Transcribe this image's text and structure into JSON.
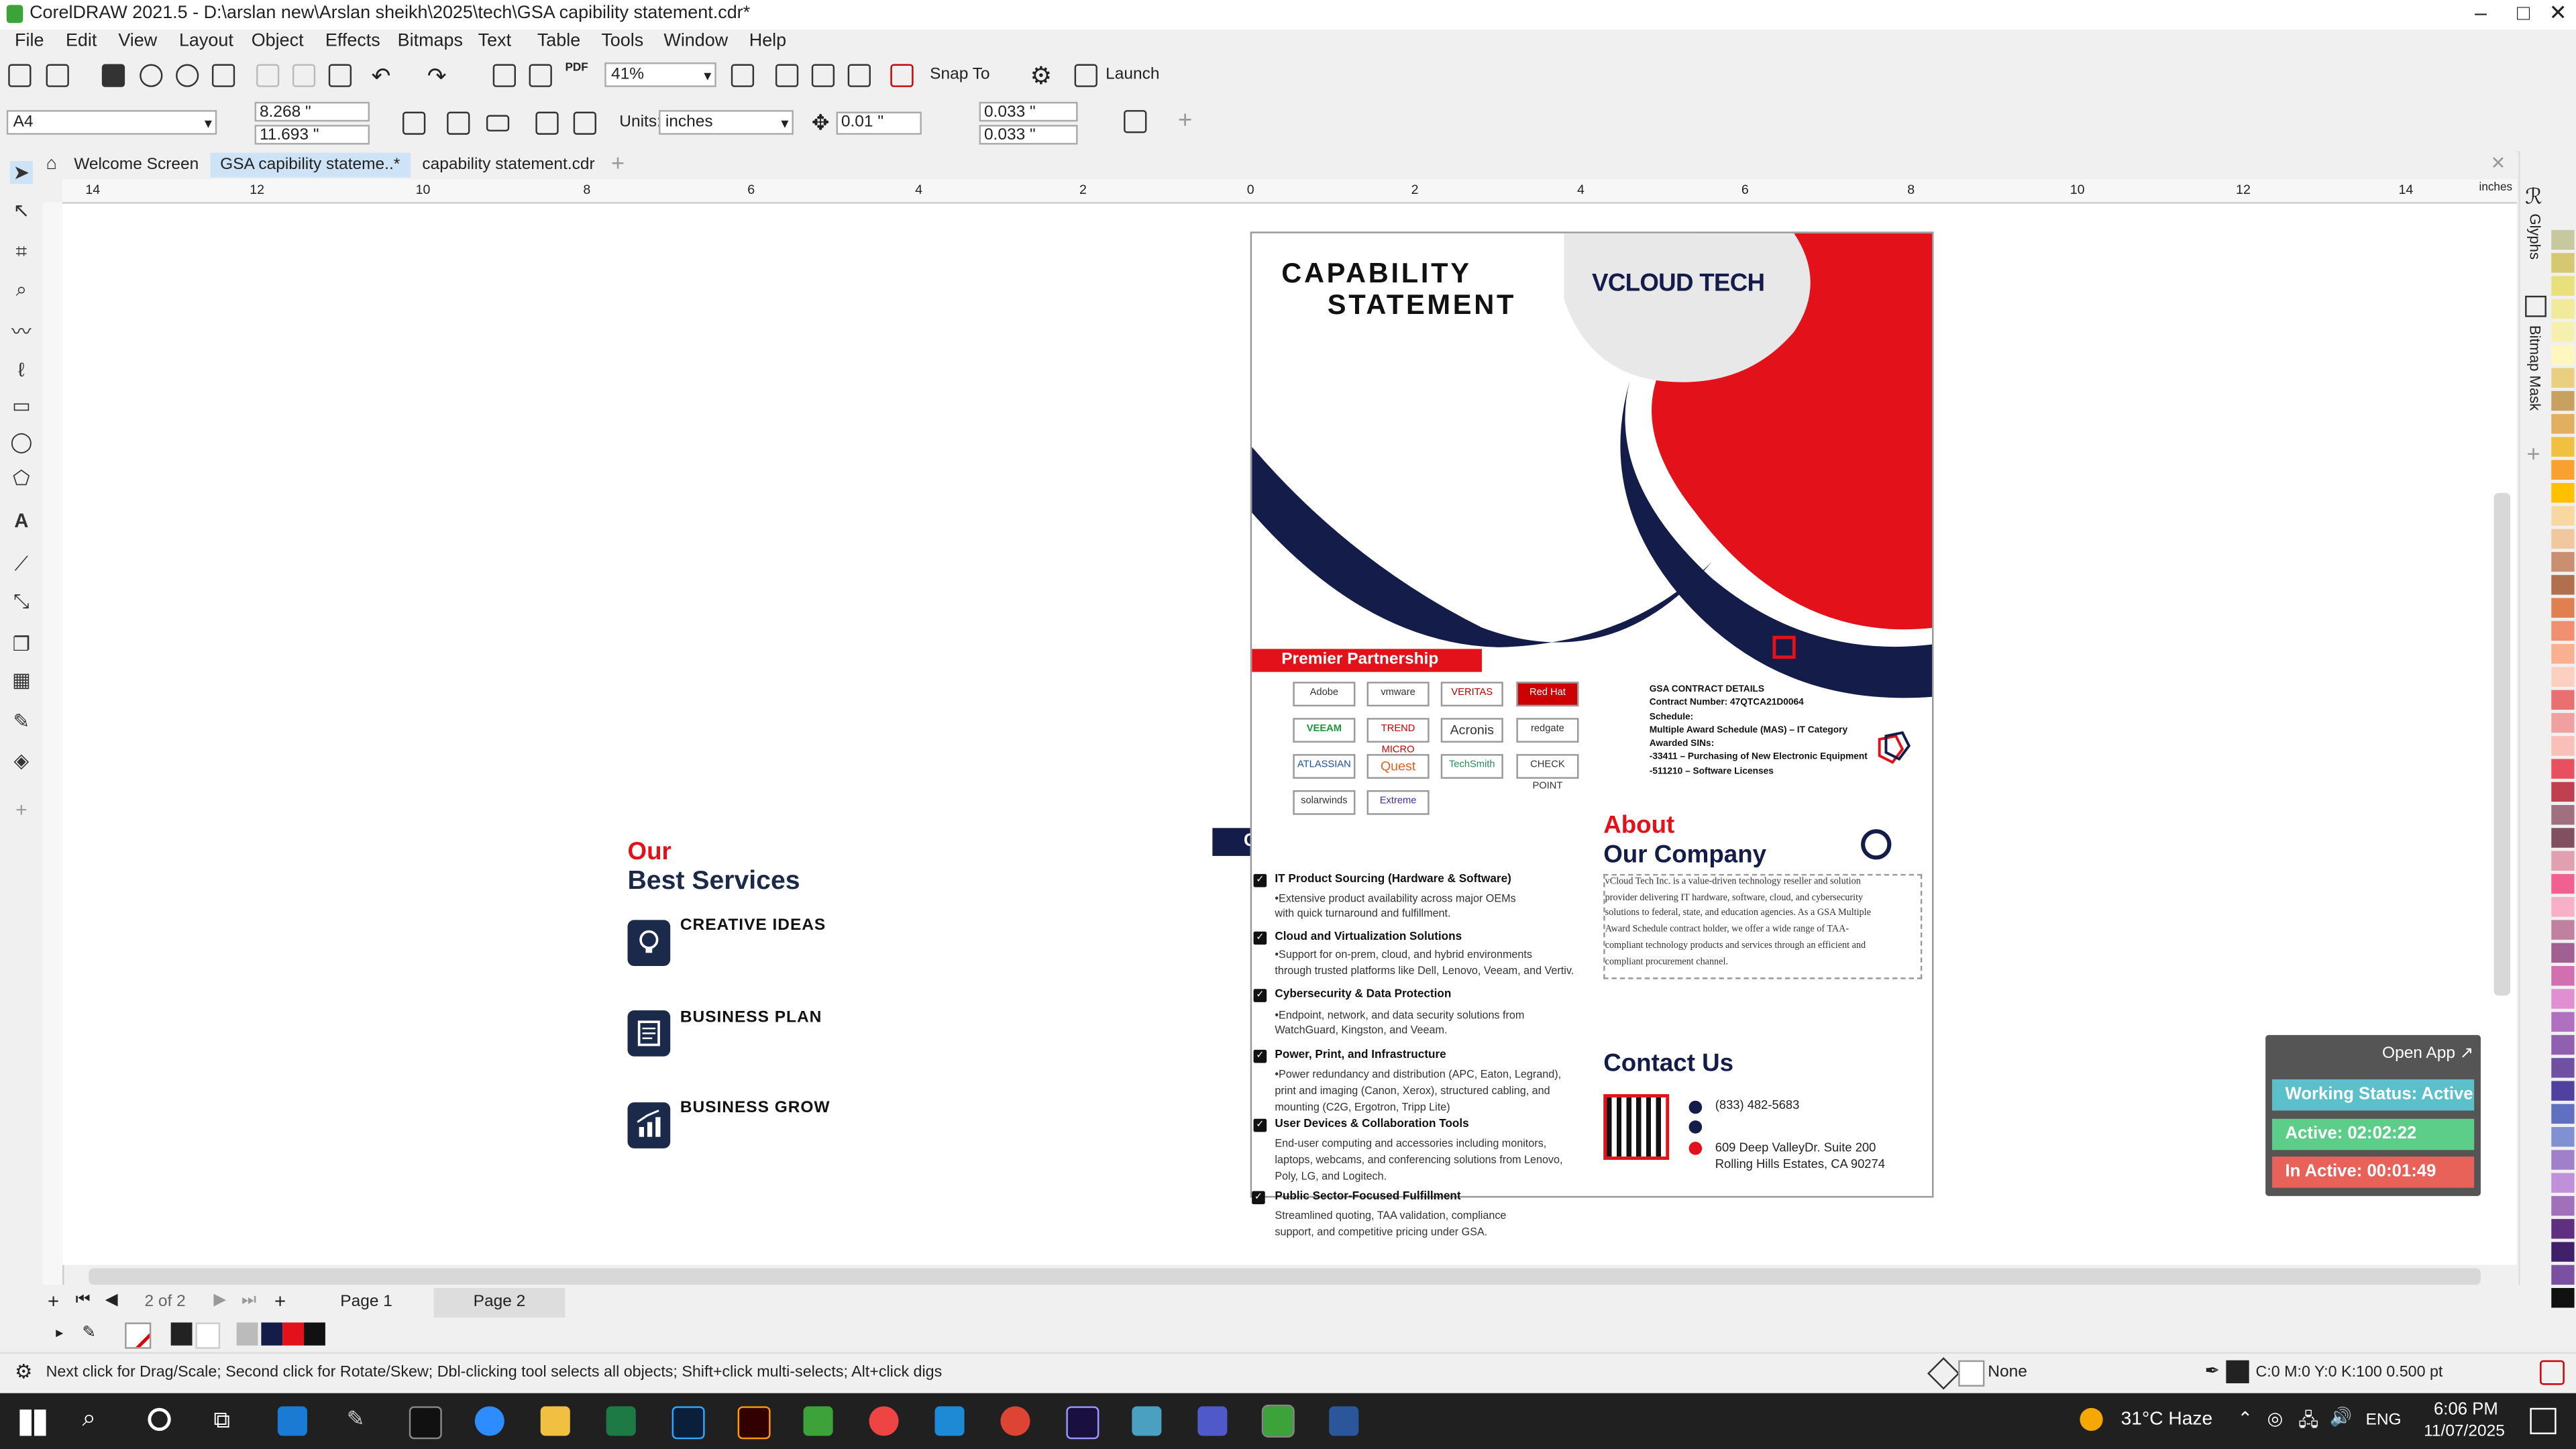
{
  "window": {
    "title": "CorelDRAW 2021.5 - D:\\arslan new\\Arslan sheikh\\2025\\tech\\GSA   capibility statement.cdr*"
  },
  "menu": [
    "File",
    "Edit",
    "View",
    "Layout",
    "Object",
    "Effects",
    "Bitmaps",
    "Text",
    "Table",
    "Tools",
    "Window",
    "Help"
  ],
  "toolbar": {
    "zoom": "41%",
    "snap_to": "Snap To",
    "launch": "Launch"
  },
  "propbar": {
    "page_size": "A4",
    "width": "8.268 \"",
    "height": "11.693 \"",
    "units_label": "Units:",
    "units": "inches",
    "nudge": "0.01 \"",
    "dup_x": "0.033 \"",
    "dup_y": "0.033 \""
  },
  "tabs": [
    "Welcome Screen",
    "GSA   capibility stateme..*",
    "capability statement.cdr"
  ],
  "ruler": {
    "labels": [
      "14",
      "12",
      "10",
      "8",
      "6",
      "4",
      "2",
      "0",
      "2",
      "4",
      "6",
      "8",
      "10",
      "12",
      "14"
    ],
    "unit": "inches"
  },
  "right_dockers": [
    "Glyphs",
    "Bitmap Mask"
  ],
  "document": {
    "header": {
      "line1": "CAPABILITY",
      "line2": "STATEMENT",
      "logo": "VCLOUD TECH"
    },
    "premier": {
      "title": "Premier Partnership",
      "logos": [
        "Adobe",
        "vmware",
        "VERITAS",
        "Red Hat",
        "VEEAM",
        "TREND MICRO",
        "Acronis",
        "redgate",
        "ATLASSIAN",
        "Quest",
        "TechSmith",
        "CHECK POINT",
        "solarwinds",
        "Extreme"
      ]
    },
    "gsa": {
      "lines": [
        "GSA CONTRACT DETAILS",
        "Contract Number: 47QTCA21D0064",
        "Schedule:",
        "Multiple Award Schedule (MAS) – IT Category",
        "Awarded SINs:",
        "-33411 – Purchasing of New Electronic Equipment",
        "-511210 – Software Licenses"
      ]
    },
    "core": {
      "title": "Core Competencies",
      "items": [
        {
          "title": "IT Product Sourcing (Hardware & Software)",
          "desc1": "•Extensive product availability across major OEMs",
          "desc2": "with quick turnaround and fulfillment."
        },
        {
          "title": "Cloud and Virtualization Solutions",
          "desc1": "•Support for on-prem, cloud, and hybrid environments",
          "desc2": "through trusted platforms like Dell, Lenovo, Veeam, and Vertiv."
        },
        {
          "title": "Cybersecurity & Data Protection",
          "desc1": "•Endpoint, network, and data security solutions from",
          "desc2": "WatchGuard, Kingston, and Veeam."
        },
        {
          "title": "Power, Print, and Infrastructure",
          "desc1": "•Power redundancy and distribution (APC, Eaton, Legrand),",
          "desc2": "print and imaging (Canon, Xerox), structured cabling, and",
          "desc3": "mounting (C2G, Ergotron, Tripp Lite)"
        },
        {
          "title": "User Devices & Collaboration Tools",
          "desc1": "End-user computing and accessories including monitors,",
          "desc2": "laptops, webcams, and conferencing solutions from Lenovo,",
          "desc3": "Poly, LG, and Logitech."
        },
        {
          "title": "Public Sector-Focused Fulfillment",
          "desc1": "Streamlined quoting, TAA validation, compliance",
          "desc2": "support, and competitive pricing under GSA."
        }
      ]
    },
    "about": {
      "title1": "About",
      "title2": "Our Company",
      "text": [
        "vCloud Tech Inc. is a value-driven technology reseller and solution",
        "provider delivering IT hardware, software, cloud, and cybersecurity",
        "solutions to federal, state, and education agencies. As a GSA Multiple",
        "Award Schedule contract holder, we offer a wide range of TAA-",
        "compliant technology products and services through an efficient and",
        "compliant procurement channel."
      ]
    },
    "contact": {
      "title": "Contact Us",
      "phone": "(833) 482-5683",
      "address1": "609 Deep ValleyDr. Suite 200",
      "address2": "Rolling Hills Estates, CA 90274"
    }
  },
  "services": {
    "title1": "Our",
    "title2": "Best Services",
    "items": [
      "CREATIVE IDEAS",
      "BUSINESS PLAN",
      "BUSINESS GROW"
    ]
  },
  "work_widget": {
    "open_app": "Open App ↗",
    "status": "Working Status: Active",
    "active": "Active: 02:02:22",
    "inactive": "In Active: 00:01:49"
  },
  "pages": {
    "counter": "2 of 2",
    "page1": "Page 1",
    "page2": "Page 2"
  },
  "statusbar": {
    "hint": "Next click for Drag/Scale; Second click for Rotate/Skew; Dbl-clicking tool selects all objects; Shift+click multi-selects; Alt+click digs",
    "fill": "None",
    "outline": "C:0 M:0 Y:0 K:100  0.500 pt"
  },
  "taskbar": {
    "weather": "31°C  Haze",
    "lang": "ENG",
    "time": "6:06 PM",
    "date": "11/07/2025"
  },
  "colors": {
    "accent_red": "#e3121a",
    "navy": "#141c4a"
  }
}
